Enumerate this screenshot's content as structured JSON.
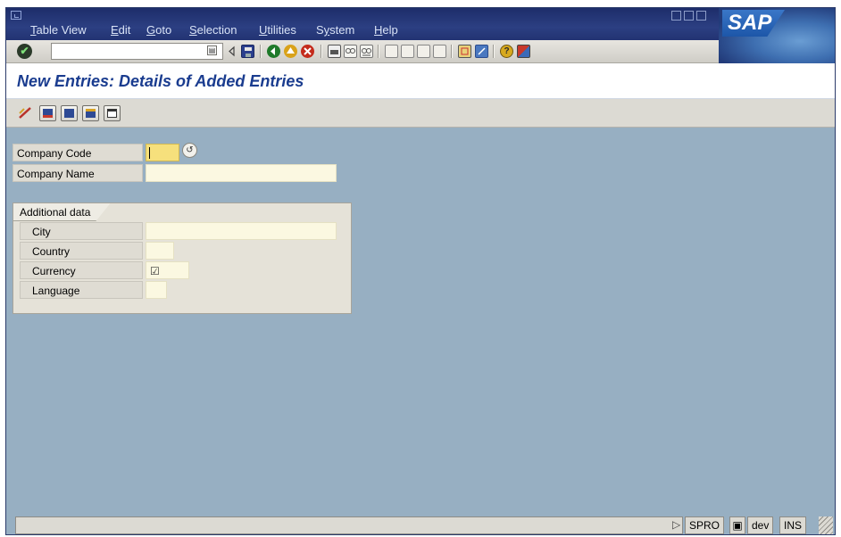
{
  "menubar": {
    "items": [
      {
        "label": "Table View",
        "mnemonic": "T",
        "rest": "able View"
      },
      {
        "label": "Edit",
        "mnemonic": "E",
        "rest": "dit"
      },
      {
        "label": "Goto",
        "mnemonic": "G",
        "rest": "oto"
      },
      {
        "label": "Selection",
        "mnemonic": "S",
        "rest": "election"
      },
      {
        "label": "Utilities",
        "mnemonic": "U",
        "rest": "tilities"
      },
      {
        "label": "System",
        "mnemonic": "y",
        "pre": "S",
        "rest": "stem"
      },
      {
        "label": "Help",
        "mnemonic": "H",
        "rest": "elp"
      }
    ],
    "logo_text": "SAP"
  },
  "stdbar": {
    "command_field_value": "",
    "icons": [
      "enter-icon",
      "back-arrow-icon",
      "save-icon",
      "back-icon",
      "exit-icon",
      "cancel-icon",
      "print-icon",
      "find-icon",
      "find-next-icon",
      "first-page-icon",
      "previous-page-icon",
      "next-page-icon",
      "last-page-icon",
      "create-session-icon",
      "shortcut-icon",
      "help-icon",
      "customize-layout-icon"
    ]
  },
  "page": {
    "title": "New Entries: Details of Added Entries"
  },
  "appbar": {
    "icons": [
      "display-change-icon",
      "delete-icon",
      "previous-entry-icon",
      "next-entry-icon",
      "select-all-icon"
    ]
  },
  "form": {
    "company_code_label": "Company Code",
    "company_code_value": "",
    "company_name_label": "Company Name",
    "company_name_value": "",
    "group_title": "Additional data",
    "city_label": "City",
    "city_value": "",
    "country_label": "Country",
    "country_value": "",
    "currency_label": "Currency",
    "currency_value": "",
    "language_label": "Language",
    "language_value": ""
  },
  "status": {
    "message": "",
    "transaction": "SPRO",
    "system": "dev",
    "mode": "INS"
  },
  "colors": {
    "background": "#97afc2",
    "title_text": "#1a3c8f",
    "required_field": "#f6e07c",
    "input_field": "#fbf8e1"
  }
}
